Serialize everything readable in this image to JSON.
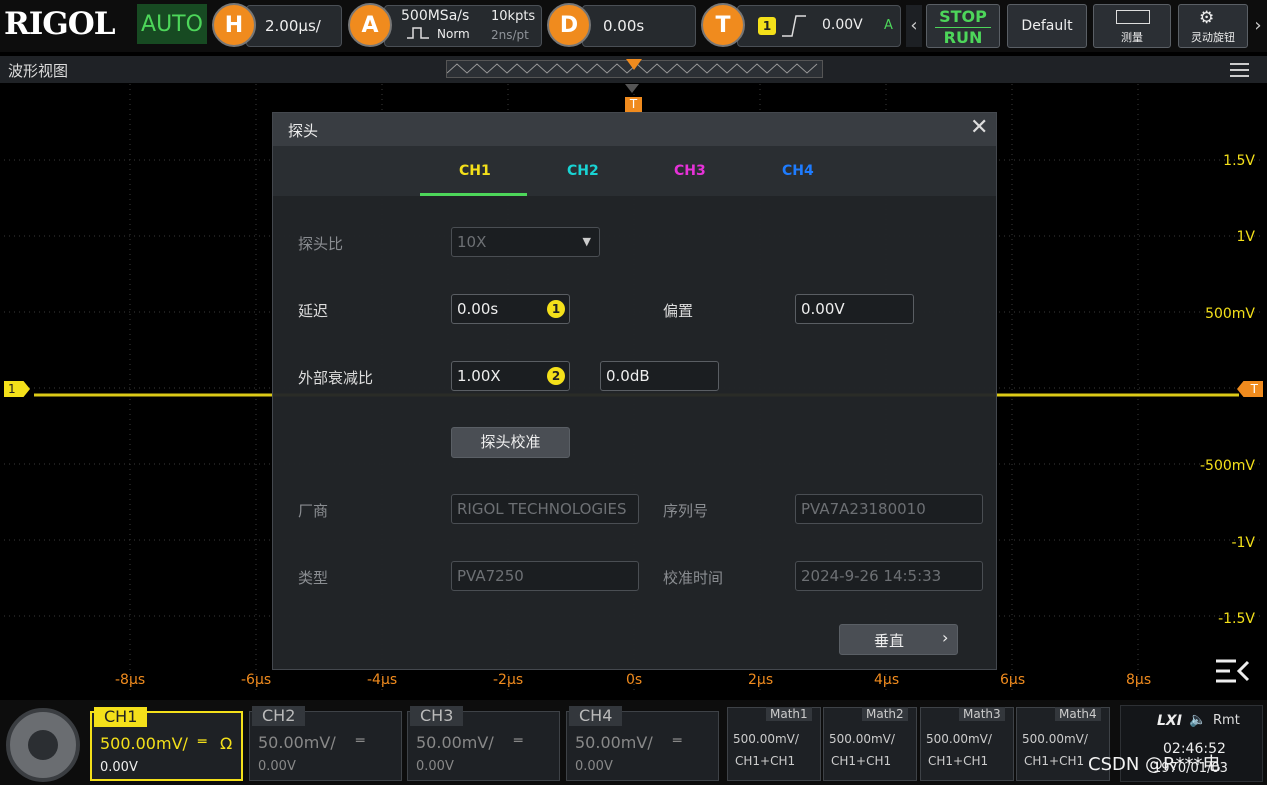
{
  "brand": "RIGOL",
  "mode": "AUTO",
  "horizontal": {
    "badge": "H",
    "value": "2.00μs/"
  },
  "acquire": {
    "badge": "A",
    "rate": "500MSa/s",
    "mode": "Norm",
    "depth": "10kpts",
    "per_point": "2ns/pt"
  },
  "delay": {
    "badge": "D",
    "value": "0.00s"
  },
  "trigger": {
    "badge": "T",
    "channel": "1",
    "level": "0.00V",
    "sweep": "A"
  },
  "run": {
    "stop": "STOP",
    "run": "RUN"
  },
  "default_btn": "Default",
  "measure_btn": "测量",
  "knob_btn": "灵动旋钮",
  "view_title": "波形视图",
  "trigger_marker": "T",
  "ch1_marker": "1",
  "y_labels": [
    "1.5V",
    "1V",
    "500mV",
    "-500mV",
    "-1V",
    "-1.5V"
  ],
  "x_labels": [
    "-8μs",
    "-6μs",
    "-4μs",
    "-2μs",
    "0s",
    "2μs",
    "4μs",
    "6μs",
    "8μs"
  ],
  "dialog": {
    "title": "探头",
    "tabs": [
      "CH1",
      "CH2",
      "CH3",
      "CH4"
    ],
    "probe_ratio_label": "探头比",
    "probe_ratio_value": "10X",
    "delay_label": "延迟",
    "delay_value": "0.00s",
    "offset_label": "偏置",
    "offset_value": "0.00V",
    "ext_att_label": "外部衰减比",
    "ext_att_value": "1.00X",
    "ext_att_db": "0.0dB",
    "calib_btn": "探头校准",
    "vendor_label": "厂商",
    "vendor_value": "RIGOL TECHNOLOGIES",
    "serial_label": "序列号",
    "serial_value": "PVA7A23180010",
    "type_label": "类型",
    "type_value": "PVA7250",
    "cal_time_label": "校准时间",
    "cal_time_value": "2024-9-26 14:5:33",
    "vertical_btn": "垂直",
    "badge1": "1",
    "badge2": "2"
  },
  "channels": [
    {
      "name": "CH1",
      "scale": "500.00mV/",
      "offset": "0.00V",
      "coupling": "Ω"
    },
    {
      "name": "CH2",
      "scale": "50.00mV/",
      "offset": "0.00V"
    },
    {
      "name": "CH3",
      "scale": "50.00mV/",
      "offset": "0.00V"
    },
    {
      "name": "CH4",
      "scale": "50.00mV/",
      "offset": "0.00V"
    }
  ],
  "maths": [
    {
      "name": "Math1",
      "scale": "500.00mV/",
      "expr": "CH1+CH1"
    },
    {
      "name": "Math2",
      "scale": "500.00mV/",
      "expr": "CH1+CH1"
    },
    {
      "name": "Math3",
      "scale": "500.00mV/",
      "expr": "CH1+CH1"
    },
    {
      "name": "Math4",
      "scale": "500.00mV/",
      "expr": "CH1+CH1"
    }
  ],
  "status": {
    "lxi": "LXI",
    "rmt": "Rmt",
    "time": "02:46:52",
    "date": "1970/01/03"
  },
  "watermark": "CSDN @R***电",
  "colors": {
    "ch1": "#f4e01a",
    "ch2": "#19d3d3",
    "ch3": "#e632d8",
    "ch4": "#1e7cff",
    "accent": "#f08b1e",
    "green": "#4dd65a"
  }
}
